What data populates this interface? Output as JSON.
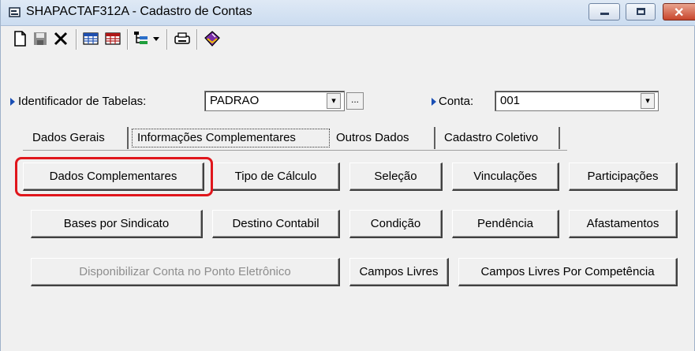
{
  "window": {
    "title": "SHAPACTAF312A - Cadastro de Contas",
    "close_glyph": "✕"
  },
  "toolbar": {
    "icons": [
      "new-document-icon",
      "save-disk-icon",
      "delete-x-icon",
      "grid-blue-icon",
      "grid-red-icon",
      "tree-view-icon",
      "dropdown-arrow-icon",
      "print-icon",
      "book-icon"
    ]
  },
  "fields": {
    "identificador_label": "Identificador de Tabelas:",
    "identificador_value": "PADRAO",
    "identificador_ellipsis": "...",
    "conta_label": "Conta:",
    "conta_value": "001",
    "drop_glyph": "▾"
  },
  "tabs": [
    {
      "label": "Dados Gerais",
      "active": false
    },
    {
      "label": "Informações Complementares",
      "active": true
    },
    {
      "label": "Outros Dados",
      "active": false
    },
    {
      "label": "Cadastro Coletivo",
      "active": false
    }
  ],
  "buttons": {
    "row1": [
      "Dados Complementares",
      "Tipo de Cálculo",
      "Seleção",
      "Vinculações",
      "Participações"
    ],
    "row2": [
      "Bases por Sindicato",
      "Destino Contabil",
      "Condição",
      "Pendência",
      "Afastamentos"
    ],
    "row3": [
      "Disponibilizar Conta no Ponto Eletrônico",
      "Campos Livres",
      "Campos Livres Por Competência"
    ]
  },
  "highlight_color": "#e0161c"
}
